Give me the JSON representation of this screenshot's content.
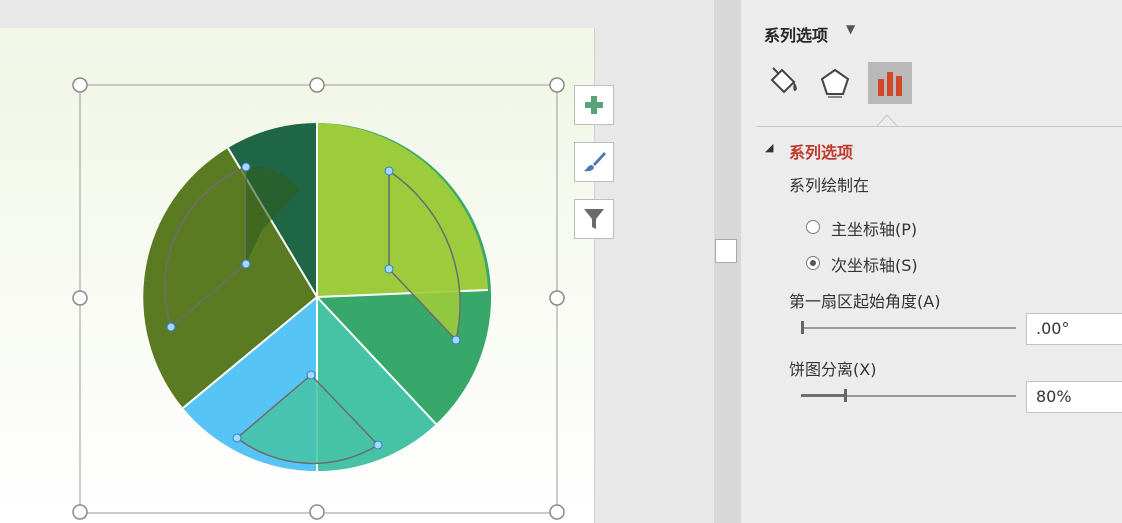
{
  "panel": {
    "title": "系列选项",
    "tabs": [
      {
        "name": "fill-line",
        "icon": "paint-bucket-icon"
      },
      {
        "name": "effects",
        "icon": "pentagon-icon"
      },
      {
        "name": "series-options",
        "icon": "bar-chart-icon",
        "active": true
      }
    ],
    "section_title": "系列选项",
    "plot_on_label": "系列绘制在",
    "primary_axis": {
      "label": "主坐标轴(P)",
      "selected": false
    },
    "secondary_axis": {
      "label": "次坐标轴(S)",
      "selected": true
    },
    "first_slice_angle": {
      "label": "第一扇区起始角度(A)",
      "value": ".00°",
      "level": 0
    },
    "pie_explosion": {
      "label": "饼图分离(X)",
      "value": "80%",
      "level": 0.2
    }
  },
  "chart_buttons": [
    {
      "name": "chart-elements-button",
      "icon": "plus-icon"
    },
    {
      "name": "chart-styles-button",
      "icon": "paintbrush-icon"
    },
    {
      "name": "chart-filters-button",
      "icon": "funnel-icon"
    }
  ],
  "colors": {
    "accent": "#c0392b",
    "active_tab_bg": "#b9b9b9",
    "bar_icon": "#d24726"
  }
}
